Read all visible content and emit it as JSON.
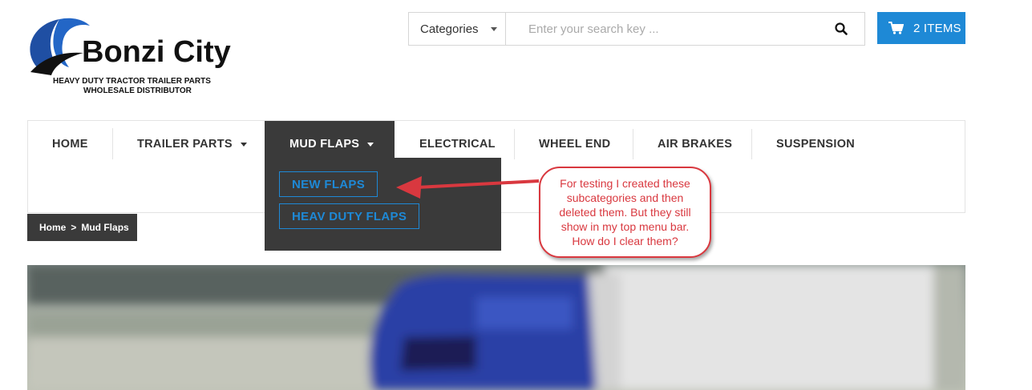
{
  "logo": {
    "name": "Bonzi City",
    "tagline_1": "HEAVY DUTY TRACTOR TRAILER PARTS",
    "tagline_2": "WHOLESALE DISTRIBUTOR"
  },
  "search": {
    "category_label": "Categories",
    "placeholder": "Enter your search key ..."
  },
  "cart": {
    "label": "2 ITEMS"
  },
  "nav": {
    "items": [
      {
        "label": "HOME"
      },
      {
        "label": "TRAILER PARTS"
      },
      {
        "label": "MUD FLAPS"
      },
      {
        "label": "ELECTRICAL"
      },
      {
        "label": "WHEEL END"
      },
      {
        "label": "AIR BRAKES"
      },
      {
        "label": "SUSPENSION"
      }
    ],
    "active": "MUD FLAPS"
  },
  "dropdown": {
    "items": [
      {
        "label": "NEW FLAPS"
      },
      {
        "label": "HEAV DUTY FLAPS"
      }
    ]
  },
  "breadcrumb": {
    "home": "Home",
    "separator": ">",
    "current": "Mud Flaps"
  },
  "annotation": {
    "text": "For testing I created these subcategories and then deleted them. But they still show in my top menu bar. How do I clear them?"
  },
  "colors": {
    "accent_blue": "#1e89d6",
    "dark_bar": "#3a3a3a",
    "annotation_red": "#d9383f"
  }
}
